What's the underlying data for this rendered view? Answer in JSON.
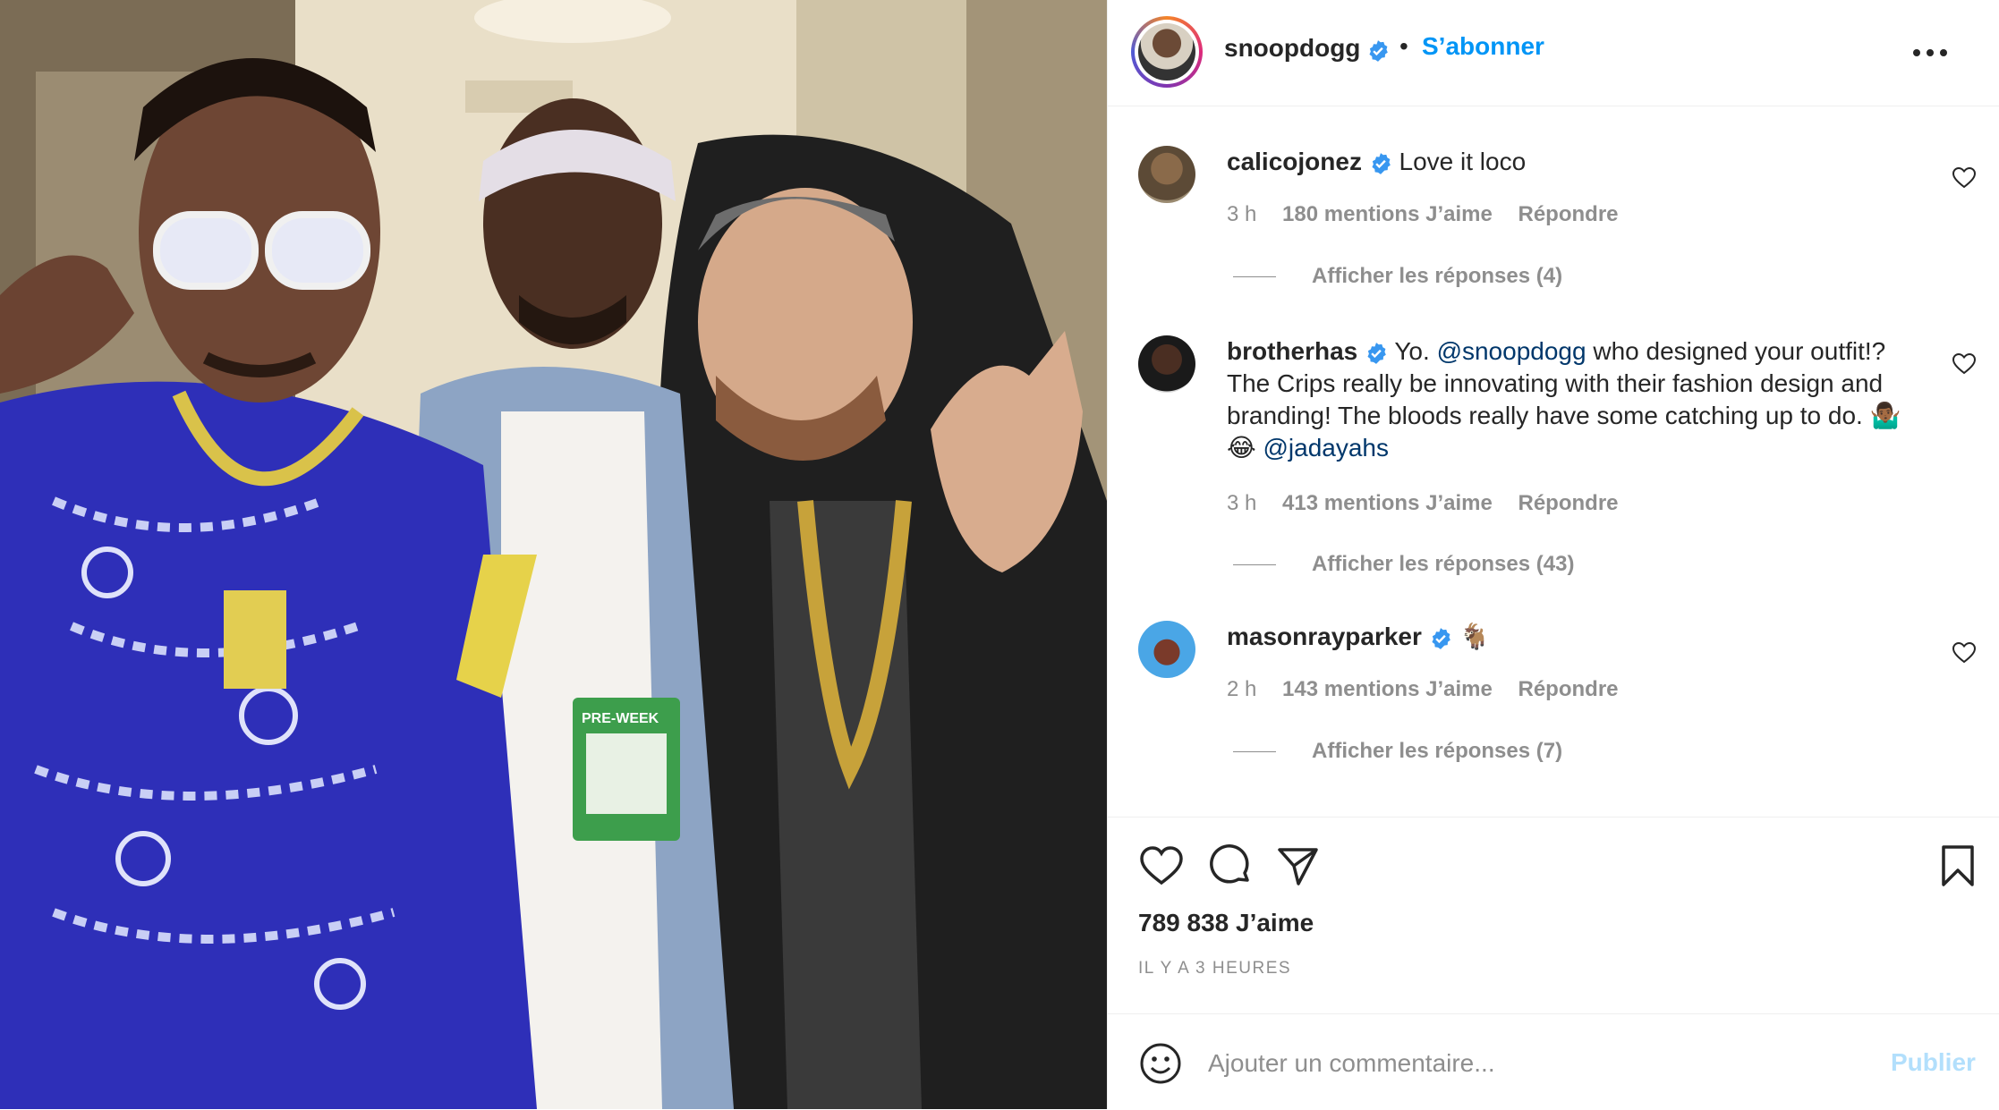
{
  "post": {
    "author": "snoopdogg",
    "follow_label": "S’abonner",
    "separator": "•",
    "photo_badge": "PRE-WEEK"
  },
  "comments": [
    {
      "username": "calicojonez",
      "verified": true,
      "text": "Love it loco",
      "time": "3 h",
      "likes": "180 mentions J’aime",
      "reply_label": "Répondre",
      "view_replies": "Afficher les réponses (4)"
    },
    {
      "username": "brotherhas",
      "verified": true,
      "text_before": "Yo.",
      "mention1": "@snoopdogg",
      "text_after": "who designed your outfit!? The Crips really be innovating with their fashion design and branding! The bloods really have some catching up to do. 🤷🏾‍♂️",
      "laugh_emoji": "😂",
      "mention2": "@jadayahs",
      "time": "3 h",
      "likes": "413 mentions J’aime",
      "reply_label": "Répondre",
      "view_replies": "Afficher les réponses (43)"
    },
    {
      "username": "masonrayparker",
      "verified": true,
      "text": "🐐",
      "time": "2 h",
      "likes": "143 mentions J’aime",
      "reply_label": "Répondre",
      "view_replies": "Afficher les réponses (7)"
    }
  ],
  "actions": {
    "icons": [
      "heart-icon",
      "comment-icon",
      "share-icon",
      "bookmark-icon"
    ],
    "likes_count": "789 838 J’aime",
    "posted_ago": "IL Y A 3 HEURES"
  },
  "add_comment": {
    "placeholder": "Ajouter un commentaire...",
    "publish_label": "Publier"
  },
  "colors": {
    "link": "#0095f6",
    "mention": "#00376b",
    "muted": "#8e8e8e",
    "verified": "#3897f0",
    "publish_disabled": "#b2dffc"
  }
}
